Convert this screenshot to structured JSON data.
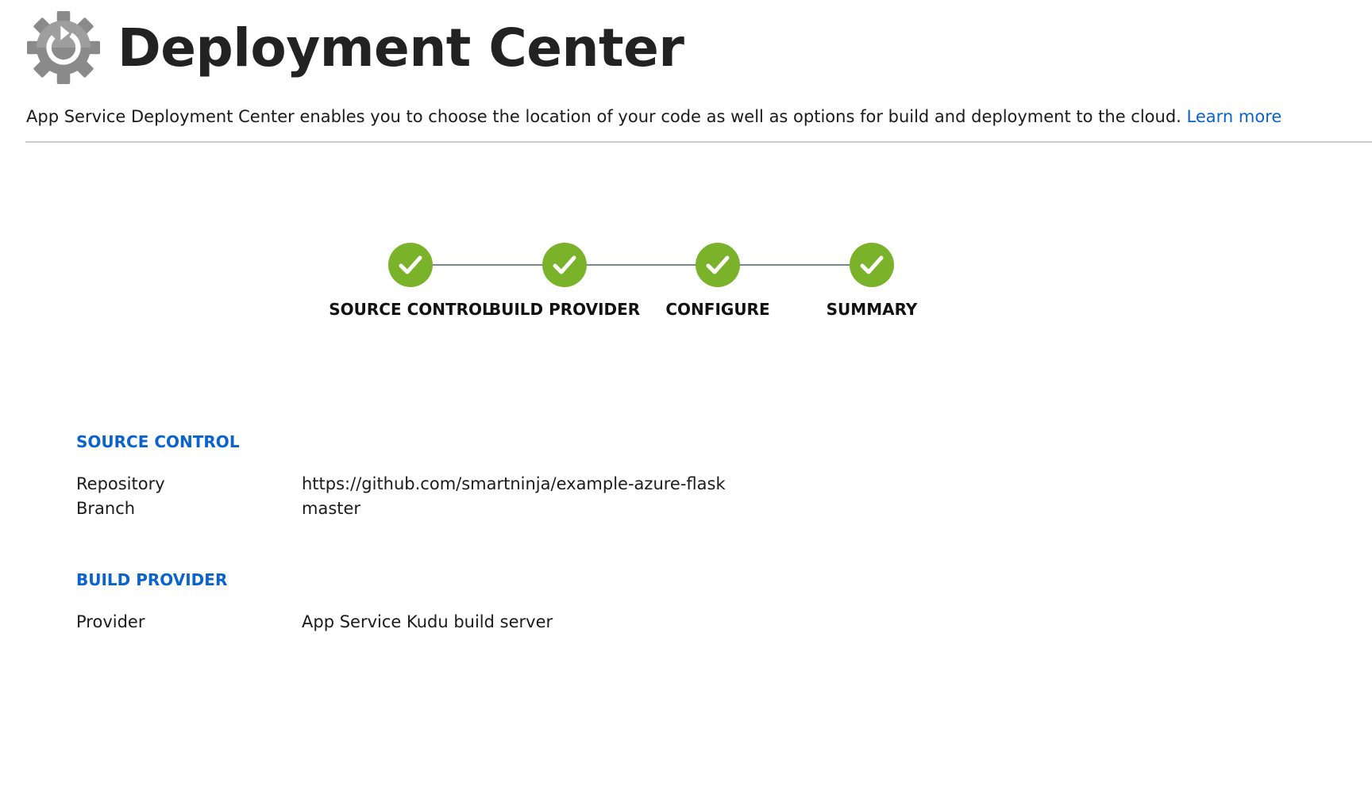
{
  "header": {
    "title": "Deployment Center",
    "icon": "gear-refresh-icon"
  },
  "description": {
    "text": "App Service Deployment Center enables you to choose the location of your code as well as options for build and deployment to the cloud. ",
    "link_label": "Learn more"
  },
  "stepper": {
    "completed_color": "#7ab32a",
    "steps": [
      {
        "label": "SOURCE CONTROL",
        "status": "completed"
      },
      {
        "label": "BUILD PROVIDER",
        "status": "completed"
      },
      {
        "label": "CONFIGURE",
        "status": "completed"
      },
      {
        "label": "SUMMARY",
        "status": "completed"
      }
    ]
  },
  "summary": {
    "source_control": {
      "title": "SOURCE CONTROL",
      "rows": [
        {
          "label": "Repository",
          "value": "https://github.com/smartninja/example-azure-flask"
        },
        {
          "label": "Branch",
          "value": "master"
        }
      ]
    },
    "build_provider": {
      "title": "BUILD PROVIDER",
      "rows": [
        {
          "label": "Provider",
          "value": "App Service Kudu build server"
        }
      ]
    }
  },
  "colors": {
    "link": "#0b63ce",
    "section_title": "#0b63ce",
    "divider": "#cfcfcf"
  }
}
